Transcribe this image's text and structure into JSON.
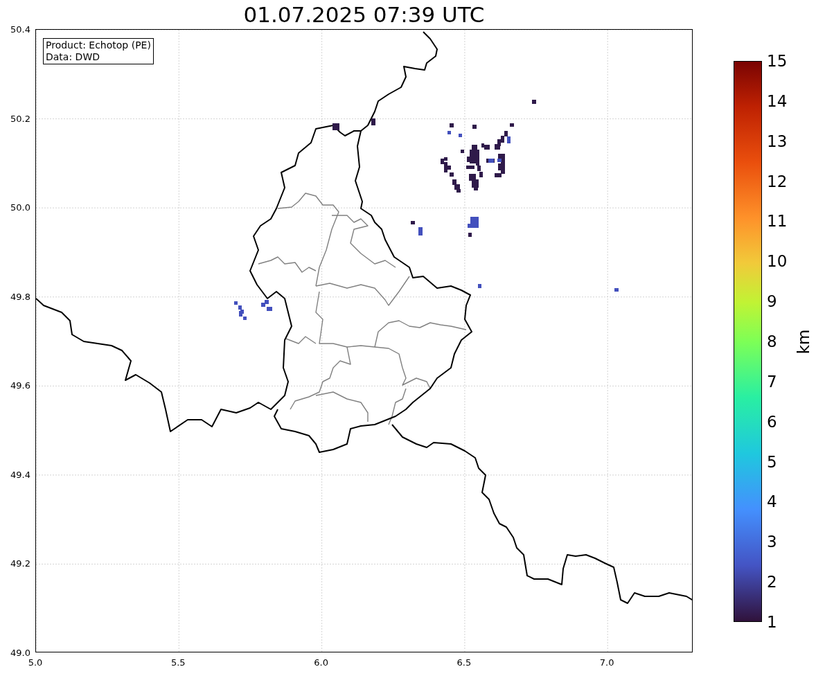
{
  "title": "01.07.2025 07:39 UTC",
  "info_box": {
    "lines": [
      "Product: Echotop (PE)",
      "Data: DWD"
    ]
  },
  "map": {
    "x_tick_labels": [
      "5.0",
      "5.5",
      "6.0",
      "6.5",
      "7.0"
    ],
    "y_tick_labels": [
      "50.4",
      "50.2",
      "50.0",
      "49.8",
      "49.6",
      "49.4",
      "49.2",
      "49.0"
    ]
  },
  "colorbar": {
    "tick_labels": [
      "15",
      "14",
      "13",
      "12",
      "11",
      "10",
      "9",
      "8",
      "7",
      "6",
      "5",
      "4",
      "3",
      "2",
      "1"
    ],
    "label": "km"
  }
}
